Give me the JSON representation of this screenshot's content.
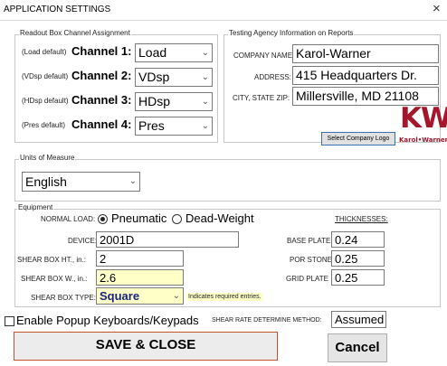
{
  "window": {
    "title": "APPLICATION SETTINGS",
    "close_glyph": "×"
  },
  "readout": {
    "group_label": "Readout Box Channel Assignment",
    "channels": [
      {
        "default_label": "(Load default)",
        "channel_label": "Channel 1:",
        "value": "Load"
      },
      {
        "default_label": "(VDsp default)",
        "channel_label": "Channel 2:",
        "value": "VDsp"
      },
      {
        "default_label": "(HDsp default)",
        "channel_label": "Channel 3:",
        "value": "HDsp"
      },
      {
        "default_label": "(Pres default)",
        "channel_label": "Channel 4:",
        "value": "Pres"
      }
    ]
  },
  "agency": {
    "group_label": "Testing Agency Information on Reports",
    "company_label": "COMPANY NAME:",
    "company_value": "Karol-Warner",
    "address_label": "ADDRESS:",
    "address_value": "415 Headquarters Dr.",
    "city_label": "CITY, STATE ZIP:",
    "city_value": "Millersville, MD 21108",
    "logo_button_label": "Select Company Logo",
    "logo_mark": "KW",
    "logo_text": "Karol•Warner"
  },
  "units": {
    "group_label": "Units of Measure",
    "value": "English"
  },
  "equipment": {
    "group_label": "Equipment",
    "normal_load_label": "NORMAL LOAD:",
    "load_options": [
      {
        "label": "Pneumatic",
        "selected": true
      },
      {
        "label": "Dead-Weight",
        "selected": false
      }
    ],
    "device_label": "DEVICE:",
    "device_value": "2001D",
    "shear_ht_label": "SHEAR BOX HT., in.:",
    "shear_ht_value": "2",
    "shear_w_label": "SHEAR BOX W., in.:",
    "shear_w_value": "2.6",
    "shear_type_label": "SHEAR BOX TYPE:",
    "shear_type_value": "Square",
    "required_note": "Indicates required entries.",
    "thickness_header": "THICKNESSES:",
    "base_plate_label": "BASE PLATE",
    "base_plate_value": "0.24",
    "por_stone_label": "POR STONE",
    "por_stone_value": "0.25",
    "grid_plate_label": "GRID PLATE",
    "grid_plate_value": "0.25"
  },
  "bottom": {
    "popup_label": "Enable Popup Keyboards/Keypads",
    "popup_checked": false,
    "shear_rate_label": "SHEAR RATE DETERMINE METHOD:",
    "shear_rate_value": "Assumed",
    "save_label": "SAVE & CLOSE",
    "cancel_label": "Cancel"
  },
  "colors": {
    "required_bg": "#ffffc8",
    "logo_red": "#a3162b",
    "save_border": "#c5502a"
  }
}
